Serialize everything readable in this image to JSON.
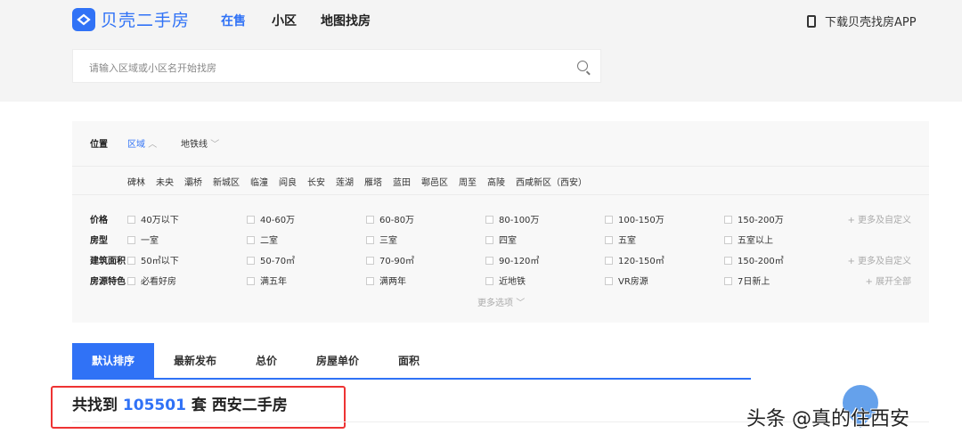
{
  "header": {
    "logo": "贝壳二手房",
    "nav": [
      "在售",
      "小区",
      "地图找房"
    ],
    "app_download": "下载贝壳找房APP"
  },
  "search": {
    "placeholder": "请输入区域或小区名开始找房"
  },
  "filters": {
    "location_label": "位置",
    "region_tab": "区域",
    "subway_tab": "地铁线",
    "districts": [
      "碑林",
      "未央",
      "灞桥",
      "新城区",
      "临潼",
      "阎良",
      "长安",
      "莲湖",
      "雁塔",
      "蓝田",
      "鄠邑区",
      "周至",
      "高陵",
      "西咸新区（西安）"
    ],
    "rows": [
      {
        "label": "价格",
        "options": [
          "40万以下",
          "40-60万",
          "60-80万",
          "80-100万",
          "100-150万",
          "150-200万"
        ],
        "more": "+ 更多及自定义"
      },
      {
        "label": "房型",
        "options": [
          "一室",
          "二室",
          "三室",
          "四室",
          "五室",
          "五室以上"
        ],
        "more": ""
      },
      {
        "label": "建筑面积",
        "options": [
          "50㎡以下",
          "50-70㎡",
          "70-90㎡",
          "90-120㎡",
          "120-150㎡",
          "150-200㎡"
        ],
        "more": "+ 更多及自定义"
      },
      {
        "label": "房源特色",
        "options": [
          "必看好房",
          "满五年",
          "满两年",
          "近地铁",
          "VR房源",
          "7日新上"
        ],
        "more": "+ 展开全部"
      }
    ],
    "more_options": "更多选项"
  },
  "sort_tabs": [
    "默认排序",
    "最新发布",
    "总价",
    "房屋单价",
    "面积"
  ],
  "result": {
    "prefix": "共找到",
    "count": "105501",
    "suffix": "套 西安二手房"
  },
  "watermark": "头条 @真的住西安"
}
